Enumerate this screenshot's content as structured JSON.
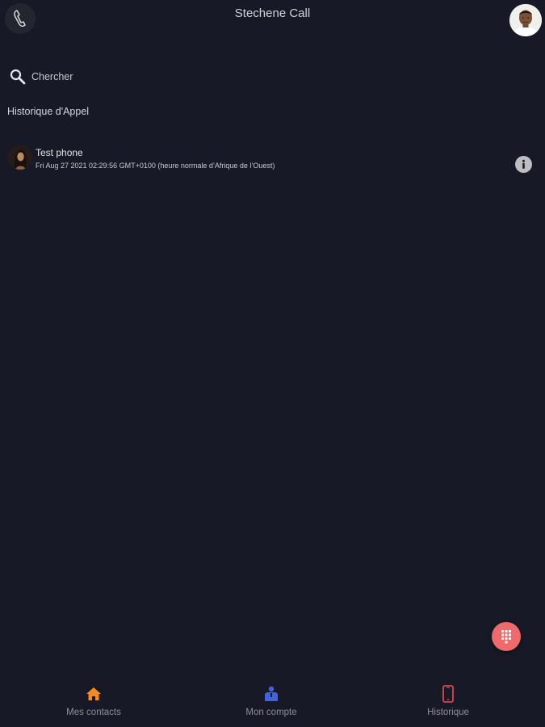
{
  "header": {
    "title": "Stechene Call",
    "logo_icon": "phone-handset-icon",
    "profile_icon": "user-avatar"
  },
  "search": {
    "placeholder": "Chercher",
    "value": ""
  },
  "history": {
    "section_title": "Historique d'Appel",
    "items": [
      {
        "name": "Test phone",
        "date": "Fri Aug 27 2021 02:29:56 GMT+0100 (heure normale d’Afrique de l’Ouest)",
        "action_icon": "info-icon"
      }
    ]
  },
  "fab": {
    "icon": "dialpad-icon",
    "color": "#ef6a6a"
  },
  "bottom_nav": {
    "items": [
      {
        "label": "Mes contacts",
        "icon": "home-icon",
        "color": "#f58a1f"
      },
      {
        "label": "Mon compte",
        "icon": "account-icon",
        "color": "#4163e0"
      },
      {
        "label": "Historique",
        "icon": "phone-history-icon",
        "color": "#d9484e"
      }
    ]
  },
  "colors": {
    "background": "#171a26",
    "text": "#d8d8dc",
    "muted_text": "#8d8e96"
  }
}
